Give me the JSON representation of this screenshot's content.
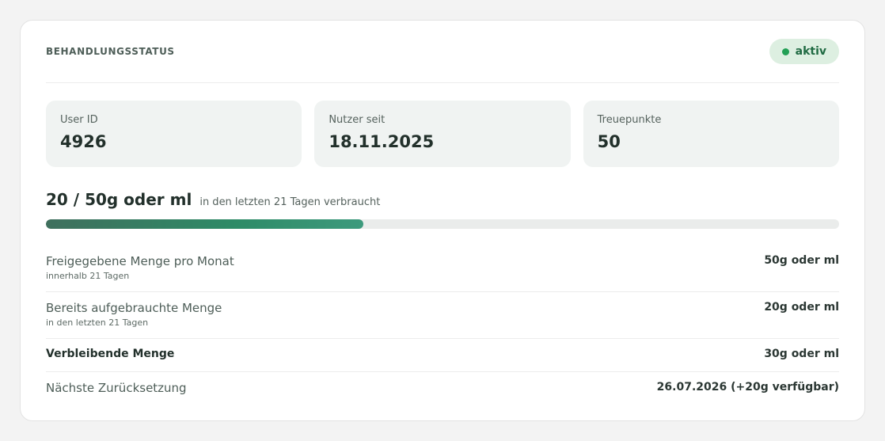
{
  "header": {
    "title": "BEHANDLUNGSSTATUS",
    "status_label": "aktiv",
    "status_color": "#22a055"
  },
  "stats": [
    {
      "label": "User ID",
      "value": "4926"
    },
    {
      "label": "Nutzer seit",
      "value": "18.11.2025"
    },
    {
      "label": "Treuepunkte",
      "value": "50"
    }
  ],
  "usage": {
    "summary": "20 / 50g oder ml",
    "subtitle": "in den letzten 21 Tagen verbraucht",
    "used": 20,
    "total": 50
  },
  "details": [
    {
      "label": "Freigegebene Menge pro Monat",
      "sub": "innerhalb 21 Tagen",
      "value": "50g oder ml"
    },
    {
      "label": "Bereits aufgebrauchte Menge",
      "sub": "in den letzten 21 Tagen",
      "value": "20g oder ml"
    },
    {
      "label": "Verbleibende Menge",
      "value": "30g oder ml"
    },
    {
      "label": "Nächste Zurücksetzung",
      "value": "26.07.2026 (+20g verfügbar)"
    }
  ]
}
